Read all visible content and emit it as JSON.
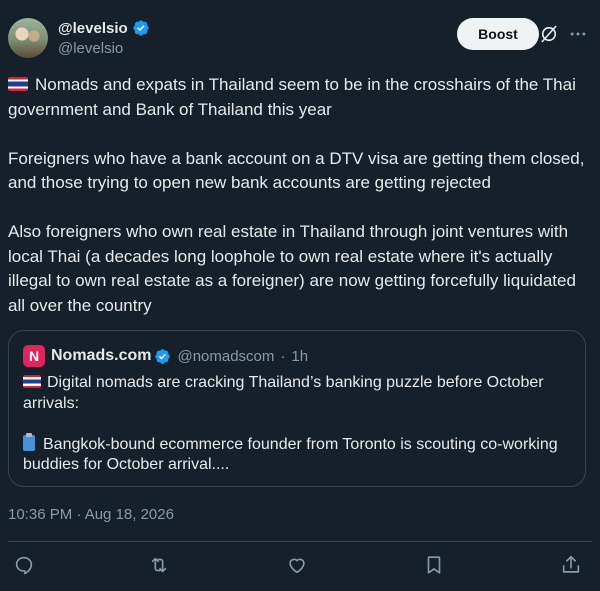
{
  "author": {
    "display_name": "@levelsio",
    "handle": "@levelsio",
    "verified": true
  },
  "header": {
    "boost_label": "Boost",
    "grok_icon": "grok-icon",
    "more_icon": "more-icon"
  },
  "tweet": {
    "paragraph_1": "Nomads and expats in Thailand seem to be in the crosshairs of the Thai government and Bank of Thailand this year",
    "paragraph_2": "Foreigners who have a bank account on a DTV visa are getting them closed, and those trying to open new bank accounts are getting rejected",
    "paragraph_3": "Also foreigners who own real estate in Thailand through joint ventures with local Thai (a decades long loophole to own real estate where it's actually illegal to own real estate as a foreigner) are now getting forcefully liquidated all over the country"
  },
  "quote": {
    "logo_letter": "N",
    "name": "Nomads.com",
    "handle": "@nomadscom",
    "separator": "·",
    "time": "1h",
    "line_1": "Digital nomads are cracking Thailand’s banking puzzle before October arrivals:",
    "line_2": "Bangkok-bound ecommerce founder from Toronto is scouting co-working buddies for October arrival...."
  },
  "timestamp": "10:36 PM · Aug 18, 2026",
  "actions": [
    "reply-icon",
    "repost-icon",
    "like-icon",
    "bookmark-icon",
    "share-icon"
  ],
  "colors": {
    "background": "#15202b",
    "text": "#e7e9ea",
    "secondary": "#8b98a5",
    "border": "#38444d",
    "verified": "#1d9bf0"
  }
}
